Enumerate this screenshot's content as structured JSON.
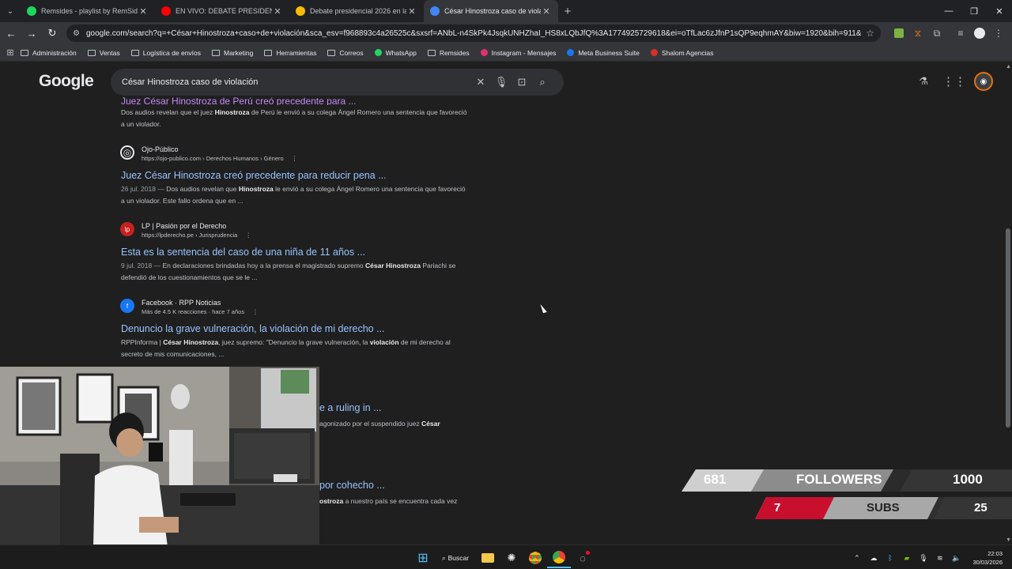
{
  "browser": {
    "tabs": [
      {
        "label": "Remsides - playlist by RemSide",
        "favicon_color": "#1ed760"
      },
      {
        "label": "EN VIVO: DEBATE PRESIDENCIA",
        "favicon_color": "#ff0000"
      },
      {
        "label": "Debate presidencial 2026 en la",
        "favicon_color": "#fbbc04"
      },
      {
        "label": "César Hinostroza caso de viola",
        "favicon_color": "#4285f4"
      }
    ],
    "active_tab": 3,
    "url": "google.com/search?q=+César+Hinostroza+caso+de+violación&sca_esv=f968893c4a26525c&sxsrf=ANbL-n4SkPk4JsqkUNHZhaI_HS8xLQbJfQ%3A1774925729618&ei=oTfLac6zJfnP1sQP9eqhmAY&biw=1920&bih=911&ved=0ahUKEwiOi...",
    "bookmarks": [
      {
        "label": "Administración",
        "type": "folder"
      },
      {
        "label": "Ventas",
        "type": "folder"
      },
      {
        "label": "Logística de envíos",
        "type": "folder"
      },
      {
        "label": "Marketing",
        "type": "folder"
      },
      {
        "label": "Herramientas",
        "type": "folder"
      },
      {
        "label": "Correos",
        "type": "folder"
      },
      {
        "label": "WhatsApp",
        "type": "site",
        "color": "#25d366"
      },
      {
        "label": "Remsides",
        "type": "folder"
      },
      {
        "label": "Instagram - Mensajes",
        "type": "site",
        "color": "#e1306c"
      },
      {
        "label": "Meta Business Suite",
        "type": "site",
        "color": "#1877f2"
      },
      {
        "label": "Shalom Agencias",
        "type": "site",
        "color": "#d93025"
      }
    ]
  },
  "google": {
    "logo": "Google",
    "query": "César Hinostroza caso de violación",
    "results_top": {
      "cut_title": "Juez César Hinostroza de Perú creó precedente para ...",
      "snippet_parts": [
        "Dos audios revelan que el juez ",
        "Hinostroza",
        " de Perú le envió a su colega Ángel Romero una sentencia que favoreció a un violador."
      ]
    },
    "results": [
      {
        "icon_letter": "◎",
        "icon_color": "#e8eaed",
        "icon_bg": "#1f1f1f",
        "source": "Ojo-Público",
        "url": "https://ojo-publico.com › Derechos Humanos › Género",
        "title": "Juez César Hinostroza creó precedente para reducir pena ...",
        "date": "26 jul. 2018 —",
        "snippet_parts": [
          " Dos audios revelan que ",
          "Hinostroza",
          " le envió a su colega Ángel Romero una sentencia que favoreció a un violador. Este fallo ordena que en ..."
        ]
      },
      {
        "icon_letter": "lp",
        "icon_color": "#ffffff",
        "icon_bg": "#c5221f",
        "source": "LP | Pasión por el Derecho",
        "url": "https://lpderecho.pe › Jurisprudencia",
        "title": "Esta es la sentencia del caso de una niña de 11 años ...",
        "date": "9 jul. 2018 —",
        "snippet_parts": [
          " En declaraciones brindadas hoy a la prensa el magistrado supremo ",
          "César Hinostroza",
          " Pariachi se defendió de los cuestionamientos que se le ..."
        ]
      },
      {
        "icon_letter": "f",
        "icon_color": "#ffffff",
        "icon_bg": "#1877f2",
        "source": "Facebook · RPP Noticias",
        "url": "Más de 4.5 K reacciones · hace 7 años",
        "title": "Denuncio la grave vulneración, la violación de mi derecho ...",
        "date": "",
        "snippet_parts": [
          "RPPInforma | ",
          "César Hinostroza",
          ", juez supremo: \"Denuncio la grave vulneración, la ",
          "violación",
          " de mi derecho al secreto de mis comunicaciones, ..."
        ]
      }
    ],
    "partial_results": [
      {
        "title": "e a ruling in ...",
        "snippet_parts": [
          "agonizado por el suspendido juez ",
          "César"
        ]
      },
      {
        "title": "por cohecho ...",
        "snippet_parts": [
          "ostroza",
          " a nuestro país se encuentra cada vez"
        ]
      }
    ]
  },
  "stream_overlay": {
    "followers_current": "681",
    "followers_label": "FOLLOWERS",
    "followers_goal": "1000",
    "subs_current": "7",
    "subs_label": "SUBS",
    "subs_goal": "25"
  },
  "taskbar": {
    "search_label": "Buscar",
    "time": "22:03",
    "date": "30/03/2026"
  }
}
